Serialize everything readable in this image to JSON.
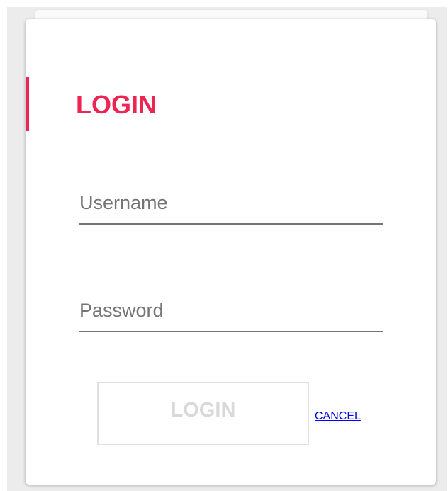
{
  "login_form": {
    "title": "LOGIN",
    "username": {
      "placeholder": "Username",
      "value": ""
    },
    "password": {
      "placeholder": "Password",
      "value": ""
    },
    "submit_label": "LOGIN",
    "cancel_label": "CANCEL"
  },
  "colors": {
    "accent": "#ed2553",
    "link": "#0000ee",
    "disabled_text": "#d9d9d9",
    "underline": "#757575"
  }
}
